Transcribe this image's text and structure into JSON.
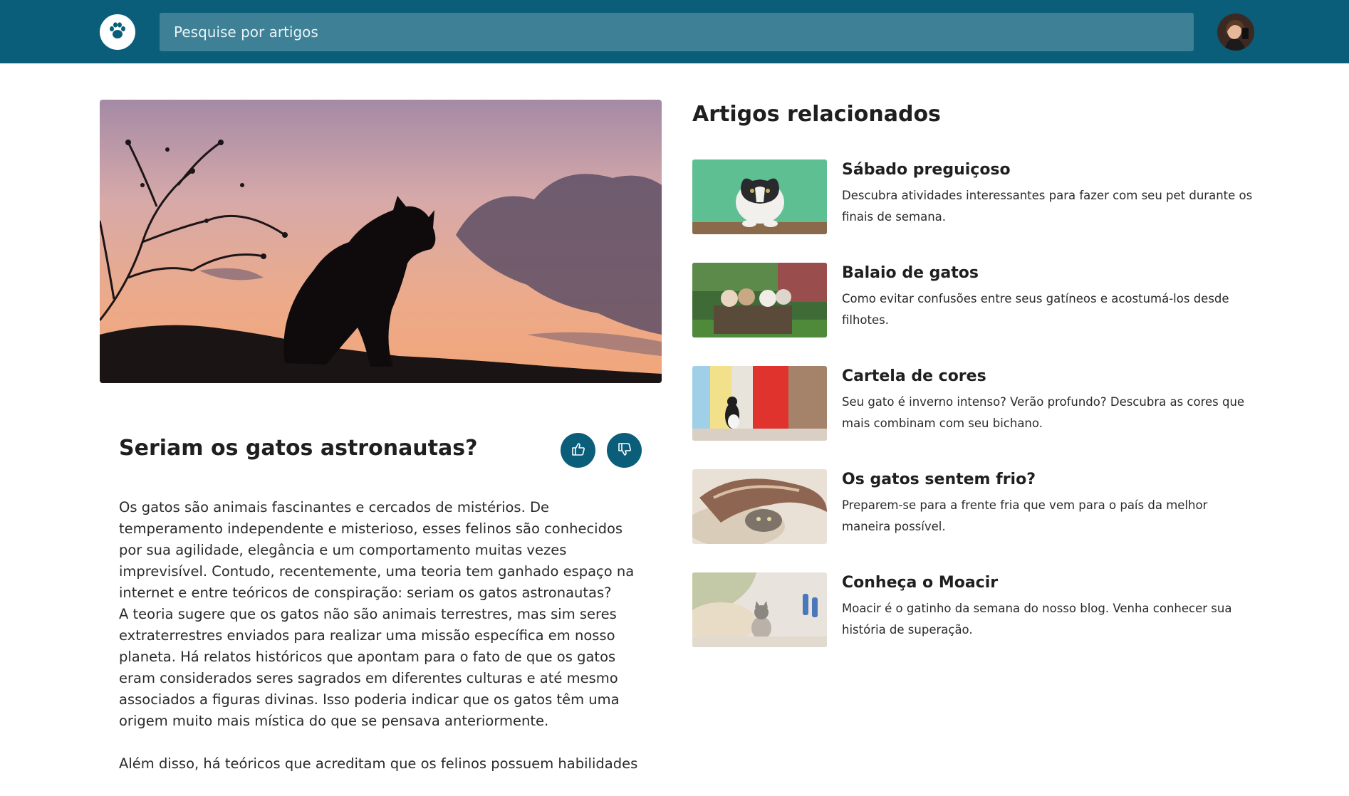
{
  "header": {
    "search_placeholder": "Pesquise por artigos",
    "logo_icon": "paw-icon",
    "avatar_icon": "user-avatar",
    "bar_color": "#0b5e7a",
    "search_color": "#3e8096"
  },
  "article": {
    "title": "Seriam os gatos astronautas?",
    "like_icon": "thumbs-up-icon",
    "dislike_icon": "thumbs-down-icon",
    "paragraphs": [
      "Os gatos são animais fascinantes e cercados de mistérios. De temperamento independente e misterioso, esses felinos são conhecidos por sua agilidade, elegância e um comportamento muitas vezes imprevisível. Contudo, recentemente, uma teoria tem ganhado espaço na internet e entre teóricos de conspiração: seriam os gatos astronautas?\nA teoria sugere que os gatos não são animais terrestres, mas sim seres extraterrestres enviados para realizar uma missão específica em nosso planeta. Há relatos históricos que apontam para o fato de que os gatos eram considerados seres sagrados em diferentes culturas e até mesmo associados a figuras divinas. Isso poderia indicar que os gatos têm uma origem muito mais mística do que se pensava anteriormente.",
      "Além disso, há teóricos que acreditam que os felinos possuem habilidades"
    ]
  },
  "related": {
    "heading": "Artigos relacionados",
    "items": [
      {
        "title": "Sábado preguiçoso",
        "description": "Descubra atividades interessantes para fazer com seu pet durante os finais de semana."
      },
      {
        "title": "Balaio de gatos",
        "description": "Como evitar confusões entre seus gatíneos e acostumá-los desde filhotes."
      },
      {
        "title": "Cartela de cores",
        "description": "Seu gato é inverno intenso? Verão profundo? Descubra as cores que mais combinam com seu bichano."
      },
      {
        "title": "Os gatos sentem frio?",
        "description": "Preparem-se para a frente fria que vem para o país da melhor maneira possível."
      },
      {
        "title": "Conheça o Moacir",
        "description": "Moacir é o gatinho da semana do nosso blog. Venha conhecer sua história de superação."
      }
    ]
  }
}
